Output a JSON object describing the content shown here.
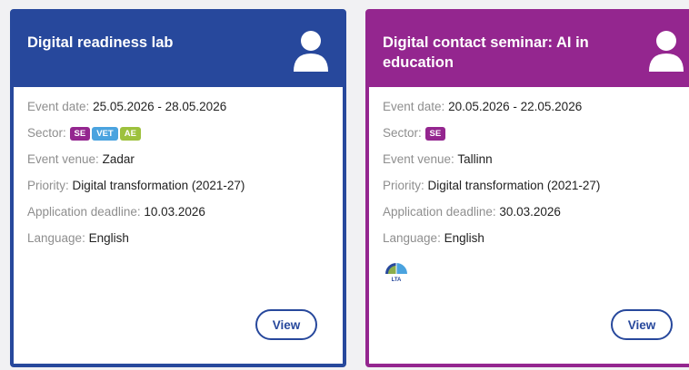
{
  "cards": [
    {
      "title": "Digital readiness lab",
      "event_date_label": "Event date:",
      "event_date": "25.05.2026 - 28.05.2026",
      "sector_label": "Sector:",
      "sectors": [
        {
          "label": "SE",
          "color": "#94268f"
        },
        {
          "label": "VET",
          "color": "#4aa3df"
        },
        {
          "label": "AE",
          "color": "#9dc13d"
        }
      ],
      "venue_label": "Event venue:",
      "venue": "Zadar",
      "priority_label": "Priority:",
      "priority": "Digital transformation (2021-27)",
      "deadline_label": "Application deadline:",
      "deadline": "10.03.2026",
      "language_label": "Language:",
      "language": "English",
      "button": "View",
      "header_color": "#27489c"
    },
    {
      "title": "Digital contact seminar: AI in education",
      "event_date_label": "Event date:",
      "event_date": "20.05.2026 - 22.05.2026",
      "sector_label": "Sector:",
      "sectors": [
        {
          "label": "SE",
          "color": "#94268f"
        }
      ],
      "venue_label": "Event venue:",
      "venue": "Tallinn",
      "priority_label": "Priority:",
      "priority": "Digital transformation (2021-27)",
      "deadline_label": "Application deadline:",
      "deadline": "30.03.2026",
      "language_label": "Language:",
      "language": "English",
      "badge_icon": "lta-icon",
      "badge_icon_text": "LTA",
      "button": "View",
      "header_color": "#94268f"
    }
  ]
}
